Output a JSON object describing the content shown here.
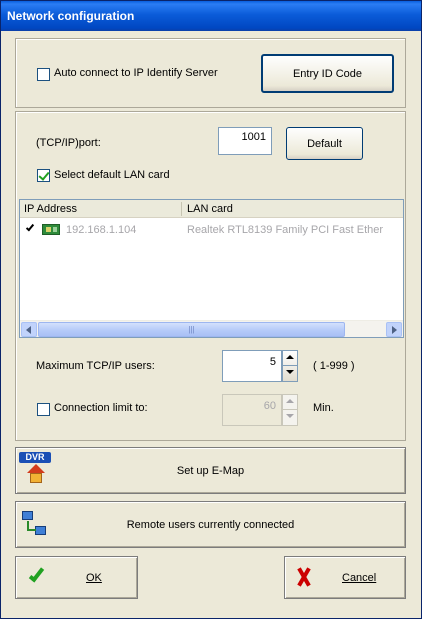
{
  "window": {
    "title": "Network configuration"
  },
  "identify": {
    "auto_connect_label": "Auto connect to IP Identify Server",
    "auto_connect_checked": false,
    "entry_id_label": "Entry ID Code"
  },
  "tcp": {
    "port_label": "(TCP/IP)port:",
    "port_value": "1001",
    "default_label": "Default",
    "select_lan_label": "Select default LAN card",
    "select_lan_checked": true
  },
  "lan_list": {
    "columns": [
      "IP Address",
      "LAN card"
    ],
    "rows": [
      {
        "checked": true,
        "ip": "192.168.1.104",
        "card": "Realtek RTL8139 Family PCI Fast Ether"
      }
    ],
    "scroll_grip": "|||"
  },
  "users": {
    "max_label": "Maximum TCP/IP users:",
    "max_value": "5",
    "range_label": "( 1-999 )",
    "limit_label": "Connection limit to:",
    "limit_checked": false,
    "limit_value": "60",
    "limit_unit": "Min."
  },
  "actions": {
    "emap_icon_text": "DVR",
    "emap_label": "Set up E-Map",
    "remote_label": "Remote users currently connected",
    "ok_label": "OK",
    "cancel_label": "Cancel"
  },
  "colors": {
    "title_bar": "#0054e3",
    "dialog_face": "#ece9d8",
    "ok_check": "#21a121",
    "cancel_x": "#cc0000"
  },
  "icons": {
    "emap": "dvr-house-icon",
    "remote": "network-computers-icon",
    "ok": "green-check-icon",
    "cancel": "red-x-icon",
    "lan": "network-card-icon"
  }
}
